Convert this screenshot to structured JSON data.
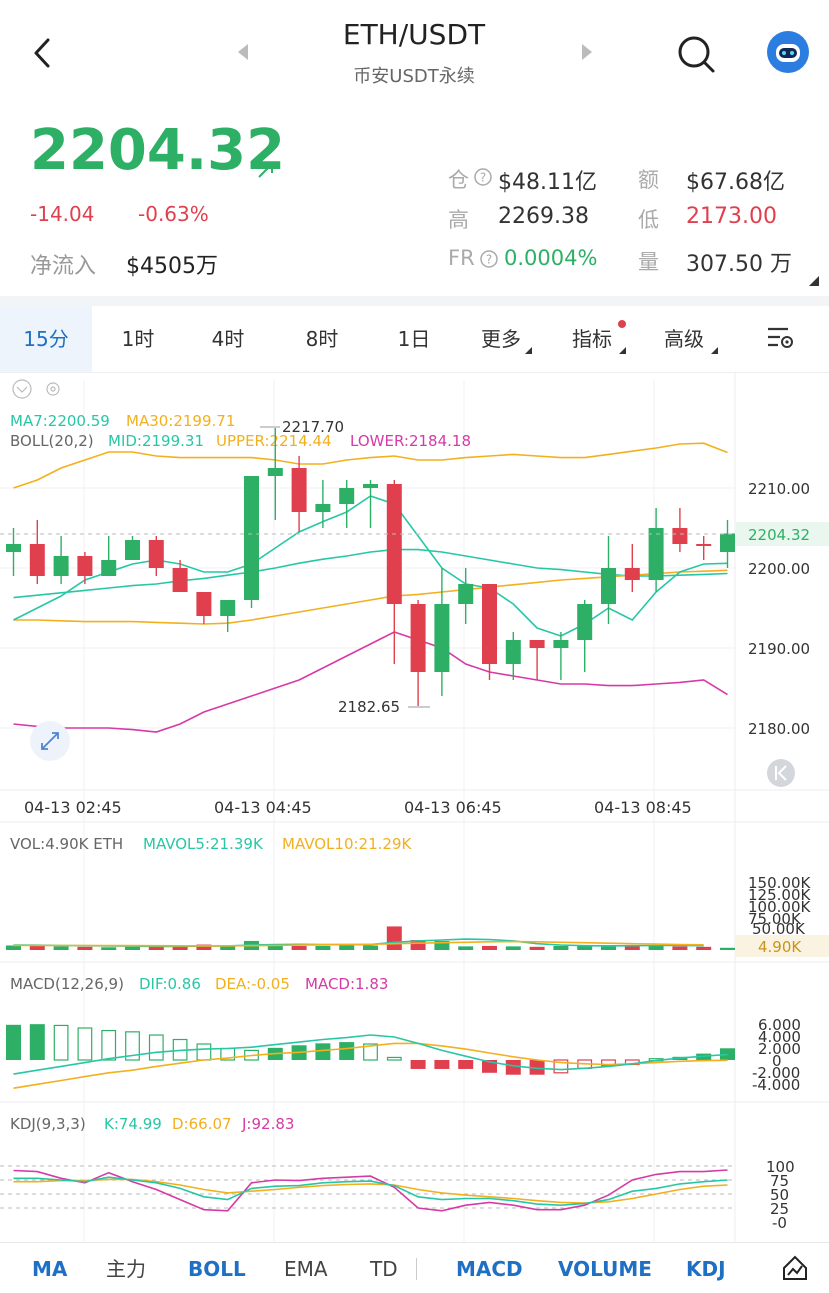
{
  "header": {
    "back_icon": "chevron-left-icon",
    "title": "ETH/USDT",
    "subtitle": "币安USDT永续",
    "search_icon": "search-icon",
    "bot_icon": "robot-avatar-icon"
  },
  "price": {
    "last": "2204.32",
    "change": "-14.04",
    "change_pct": "-0.63%",
    "net_inflow_label": "净流入",
    "net_inflow": "$4505万"
  },
  "stats": {
    "oi_label": "仓",
    "oi": "$48.11亿",
    "amount_label": "额",
    "amount": "$67.68亿",
    "high_label": "高",
    "high": "2269.38",
    "low_label": "低",
    "low": "2173.00",
    "fr_label": "FR",
    "fr": "0.0004%",
    "vol_label": "量",
    "vol": "307.50 万"
  },
  "timeframes": [
    "15分",
    "1时",
    "4时",
    "8时",
    "1日",
    "更多",
    "指标",
    "高级"
  ],
  "selected_timeframe": "15分",
  "colors": {
    "up": "#2db065",
    "down": "#e0404e",
    "blue": "#1f6fc5",
    "ma7": "#27c7a6",
    "ma30": "#f2b01e",
    "boll_upper": "#f2b01e",
    "boll_mid": "#27c7a6",
    "boll_lower": "#d63aa6"
  },
  "main_chart": {
    "ma7_label": "MA7:2200.59",
    "ma30_label": "MA30:2199.71",
    "boll_label": "BOLL(20,2)",
    "boll_mid_label": "MID:2199.31",
    "boll_upper_label": "UPPER:2214.44",
    "boll_lower_label": "LOWER:2184.18",
    "max_label": "2217.70",
    "min_label": "2182.65",
    "last_label": "2204.32",
    "y_ticks": [
      "2210.00",
      "2200.00",
      "2190.00",
      "2180.00"
    ],
    "x_ticks": [
      "04-13 02:45",
      "04-13 04:45",
      "04-13 06:45",
      "04-13 08:45"
    ]
  },
  "vol_panel": {
    "label": "VOL:4.90K ETH",
    "mavol5_label": "MAVOL5:21.39K",
    "mavol10_label": "MAVOL10:21.29K",
    "y_ticks": [
      "150.00K",
      "125.00K",
      "100.00K",
      "75.00K",
      "50.00K"
    ],
    "last_label": "4.90K"
  },
  "macd_panel": {
    "label": "MACD(12,26,9)",
    "dif_label": "DIF:0.86",
    "dea_label": "DEA:-0.05",
    "macd_label": "MACD:1.83",
    "y_ticks": [
      "6.000",
      "4.000",
      "2.000",
      "0",
      "-2.000",
      "-4.000"
    ]
  },
  "kdj_panel": {
    "label": "KDJ(9,3,3)",
    "k_label": "K:74.99",
    "d_label": "D:66.07",
    "j_label": "J:92.83",
    "y_ticks": [
      "100",
      "75",
      "50",
      "25",
      "-0"
    ]
  },
  "bottom_bar": [
    "MA",
    "主力",
    "BOLL",
    "EMA",
    "TD",
    "MACD",
    "VOLUME",
    "KDJ"
  ],
  "chart_data": {
    "type": "candlestick",
    "title": "ETH/USDT",
    "interval": "15分",
    "candles": [
      {
        "o": 2202,
        "h": 2205,
        "l": 2199,
        "c": 2203
      },
      {
        "o": 2203,
        "h": 2206,
        "l": 2198,
        "c": 2199
      },
      {
        "o": 2199,
        "h": 2204,
        "l": 2198,
        "c": 2201.5
      },
      {
        "o": 2201.5,
        "h": 2202,
        "l": 2198,
        "c": 2199
      },
      {
        "o": 2199,
        "h": 2204,
        "l": 2199,
        "c": 2201
      },
      {
        "o": 2201,
        "h": 2204,
        "l": 2201,
        "c": 2203.5
      },
      {
        "o": 2203.5,
        "h": 2204,
        "l": 2199,
        "c": 2200
      },
      {
        "o": 2200,
        "h": 2201,
        "l": 2197,
        "c": 2197
      },
      {
        "o": 2197,
        "h": 2197,
        "l": 2193,
        "c": 2194
      },
      {
        "o": 2194,
        "h": 2196,
        "l": 2192,
        "c": 2196
      },
      {
        "o": 2196,
        "h": 2206,
        "l": 2195,
        "c": 2211.5
      },
      {
        "o": 2211.5,
        "h": 2217.7,
        "l": 2206,
        "c": 2212.5
      },
      {
        "o": 2212.5,
        "h": 2214,
        "l": 2204.5,
        "c": 2207
      },
      {
        "o": 2207,
        "h": 2211,
        "l": 2205,
        "c": 2208
      },
      {
        "o": 2208,
        "h": 2211,
        "l": 2205,
        "c": 2210
      },
      {
        "o": 2210,
        "h": 2211,
        "l": 2205,
        "c": 2210.5
      },
      {
        "o": 2210.5,
        "h": 2211,
        "l": 2188,
        "c": 2195.5
      },
      {
        "o": 2195.5,
        "h": 2196,
        "l": 2182.65,
        "c": 2187
      },
      {
        "o": 2187,
        "h": 2200,
        "l": 2184,
        "c": 2195.5
      },
      {
        "o": 2195.5,
        "h": 2200,
        "l": 2193,
        "c": 2198
      },
      {
        "o": 2198,
        "h": 2198,
        "l": 2186,
        "c": 2188
      },
      {
        "o": 2188,
        "h": 2192,
        "l": 2186,
        "c": 2191
      },
      {
        "o": 2191,
        "h": 2191,
        "l": 2186,
        "c": 2190
      },
      {
        "o": 2190,
        "h": 2192,
        "l": 2186,
        "c": 2191
      },
      {
        "o": 2191,
        "h": 2196,
        "l": 2187,
        "c": 2195.5
      },
      {
        "o": 2195.5,
        "h": 2204,
        "l": 2193,
        "c": 2200
      },
      {
        "o": 2200,
        "h": 2203,
        "l": 2197,
        "c": 2198.5
      },
      {
        "o": 2198.5,
        "h": 2207.5,
        "l": 2197,
        "c": 2205
      },
      {
        "o": 2205,
        "h": 2207.5,
        "l": 2202,
        "c": 2203
      },
      {
        "o": 2203,
        "h": 2204,
        "l": 2201,
        "c": 2202.8
      },
      {
        "o": 2202,
        "h": 2206,
        "l": 2200,
        "c": 2204.32
      }
    ],
    "boll_upper": [
      2210,
      2211,
      2212.5,
      2213.5,
      2214.5,
      2214.5,
      2214,
      2213.8,
      2213.8,
      2213.8,
      2213.8,
      2213.5,
      2213,
      2213,
      2213.5,
      2213.8,
      2214,
      2213.5,
      2213.5,
      2213.8,
      2214,
      2214.2,
      2214,
      2213.8,
      2213.8,
      2214.2,
      2214.6,
      2215,
      2215.5,
      2215.6,
      2214.44
    ],
    "boll_mid": [
      2196.3,
      2196.6,
      2196.9,
      2197.2,
      2197.5,
      2197.8,
      2198,
      2198.4,
      2198.7,
      2199.1,
      2199.5,
      2200,
      2200.6,
      2201.1,
      2201.5,
      2202,
      2202.3,
      2202.3,
      2202,
      2201.5,
      2201,
      2200.5,
      2200,
      2199.8,
      2199.5,
      2199.2,
      2199,
      2199,
      2199.1,
      2199.2,
      2199.31
    ],
    "boll_lower": [
      2180.5,
      2180.2,
      2180,
      2180,
      2180,
      2179.8,
      2179.5,
      2180.5,
      2182,
      2183,
      2184,
      2185,
      2186,
      2187.5,
      2189,
      2190.5,
      2192,
      2191,
      2190,
      2188,
      2187,
      2186.5,
      2186,
      2185.5,
      2185.5,
      2185.3,
      2185.3,
      2185.5,
      2185.7,
      2186,
      2184.18
    ],
    "ma7": [
      2193.5,
      2195,
      2196.5,
      2198.5,
      2199.5,
      2200.5,
      2201,
      2200.5,
      2199.5,
      2199.5,
      2200.5,
      2202.5,
      2204.5,
      2205.8,
      2207,
      2209,
      2208,
      2204,
      2200,
      2198,
      2197.5,
      2195.5,
      2192.5,
      2191.5,
      2193,
      2195,
      2193.5,
      2197,
      2199.5,
      2200.5,
      2200.59
    ],
    "ma30": [
      2193.5,
      2193.5,
      2193.4,
      2193.3,
      2193.3,
      2193.3,
      2193.2,
      2193.1,
      2193,
      2193.1,
      2193.5,
      2194,
      2194.5,
      2195,
      2195.5,
      2196,
      2196.5,
      2196.7,
      2197,
      2197.3,
      2197.6,
      2197.9,
      2198.2,
      2198.5,
      2198.7,
      2198.9,
      2199.1,
      2199.3,
      2199.5,
      2199.6,
      2199.71
    ],
    "volume": [
      10,
      9,
      8,
      7,
      6,
      7,
      8,
      9,
      12,
      9,
      20,
      11,
      9,
      9,
      10,
      10,
      52,
      22,
      20,
      8,
      9,
      8,
      7,
      9,
      10,
      11,
      9,
      10,
      8,
      7,
      4.9
    ],
    "mavol5": [
      11,
      10.5,
      10,
      9.5,
      9,
      8.5,
      8,
      8,
      8.5,
      9,
      11,
      12,
      12.5,
      12,
      12,
      12,
      17,
      20,
      22,
      24,
      23,
      20,
      14,
      11,
      9.5,
      9,
      9.5,
      10,
      10,
      9.5,
      21.39
    ],
    "mavol10": [
      10,
      10,
      10,
      10,
      9.8,
      9.6,
      9.4,
      9.2,
      9,
      9.2,
      9.5,
      10,
      11,
      11.5,
      12,
      12.5,
      14,
      15,
      16,
      17,
      18,
      18.5,
      18,
      17,
      16,
      15,
      14,
      13,
      12,
      11.5,
      21.29
    ],
    "macd_hist": [
      5.5,
      5.6,
      5.4,
      5,
      4.6,
      4.4,
      3.9,
      3.2,
      2.5,
      1.8,
      1.5,
      1.9,
      2.3,
      2.6,
      2.8,
      2.5,
      0.4,
      -1.4,
      -1.4,
      -1.4,
      -2.0,
      -2.3,
      -2.3,
      -2.0,
      -1.3,
      -0.9,
      -0.7,
      0.2,
      0.5,
      1.0,
      1.83
    ],
    "macd_dif": [
      -2.2,
      -1.6,
      -1,
      -0.4,
      0.2,
      0.7,
      1.2,
      1.5,
      1.7,
      1.8,
      2,
      2.4,
      2.8,
      3.2,
      3.5,
      3.9,
      3.6,
      2.6,
      1.5,
      0.6,
      -0.3,
      -0.9,
      -1.3,
      -1.5,
      -1.3,
      -1,
      -0.6,
      -0.1,
      0.3,
      0.6,
      0.86
    ],
    "macd_dea": [
      -4.4,
      -3.8,
      -3.2,
      -2.6,
      -2,
      -1.6,
      -1,
      -0.5,
      0,
      0.3,
      0.7,
      1,
      1.2,
      1.5,
      1.8,
      2.2,
      2.6,
      2.6,
      2.2,
      1.7,
      1.1,
      0.5,
      0,
      -0.4,
      -0.6,
      -0.7,
      -0.6,
      -0.4,
      -0.2,
      -0.1,
      -0.05
    ],
    "kdj_k": [
      78,
      78,
      75,
      72,
      80,
      75,
      70,
      60,
      45,
      40,
      60,
      64,
      65,
      70,
      72,
      73,
      65,
      45,
      40,
      42,
      42,
      38,
      32,
      30,
      33,
      40,
      55,
      60,
      68,
      72,
      74.99
    ],
    "kdj_d": [
      72,
      72,
      74,
      74,
      76,
      76,
      72,
      66,
      58,
      52,
      55,
      58,
      62,
      65,
      67,
      68,
      66,
      58,
      52,
      48,
      45,
      42,
      38,
      35,
      34,
      36,
      42,
      50,
      58,
      64,
      66.07
    ],
    "kdj_j": [
      92,
      90,
      78,
      70,
      88,
      72,
      58,
      40,
      22,
      20,
      70,
      75,
      74,
      78,
      80,
      82,
      62,
      25,
      20,
      30,
      35,
      30,
      22,
      22,
      30,
      48,
      75,
      85,
      90,
      90,
      92.83
    ]
  }
}
